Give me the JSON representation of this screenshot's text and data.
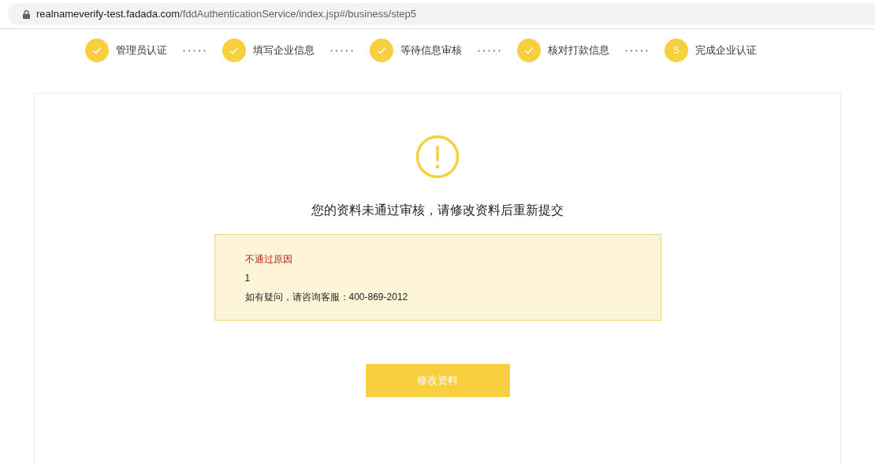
{
  "address_bar": {
    "url_host": "realnameverify-test.fadada.com",
    "url_path": "/fddAuthenticationService/index.jsp#/business/step5"
  },
  "steps": [
    {
      "label": "管理员认证",
      "kind": "done"
    },
    {
      "label": "填写企业信息",
      "kind": "done"
    },
    {
      "label": "等待信息审核",
      "kind": "done"
    },
    {
      "label": "核对打款信息",
      "kind": "done"
    },
    {
      "label": "完成企业认证",
      "kind": "current",
      "number": "5"
    }
  ],
  "result": {
    "title": "您的资料未通过审核，请修改资料后重新提交",
    "notice": {
      "heading": "不通过原因",
      "reason": "1",
      "contact": "如有疑问，请咨询客服：400-869-2012"
    },
    "button": "修改资料"
  }
}
